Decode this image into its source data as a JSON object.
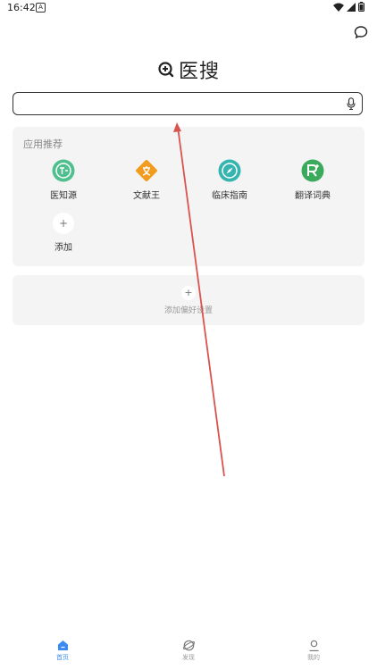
{
  "status_bar": {
    "time": "16:42",
    "notification_glyph": "A"
  },
  "header": {
    "logo_text": "医搜"
  },
  "search": {
    "placeholder": "",
    "value": ""
  },
  "apps": {
    "title": "应用推荐",
    "items": [
      {
        "label": "医知源",
        "icon": "yizhiyuan-icon",
        "color": "#4fc08d"
      },
      {
        "label": "文献王",
        "icon": "wenxianwang-icon",
        "color": "#f29c1f"
      },
      {
        "label": "临床指南",
        "icon": "compass-icon",
        "color": "#36b5b0"
      },
      {
        "label": "翻译词典",
        "icon": "translate-icon",
        "color": "#3aaa5c"
      }
    ],
    "add_label": "添加"
  },
  "preferences": {
    "add_label": "添加偏好设置"
  },
  "bottom_nav": [
    {
      "label": "首页",
      "icon": "home-icon",
      "active": true
    },
    {
      "label": "发现",
      "icon": "discover-icon",
      "active": false
    },
    {
      "label": "我的",
      "icon": "profile-icon",
      "active": false
    }
  ],
  "colors": {
    "accent": "#3b8cf1",
    "annotation_arrow": "#d9534f"
  }
}
